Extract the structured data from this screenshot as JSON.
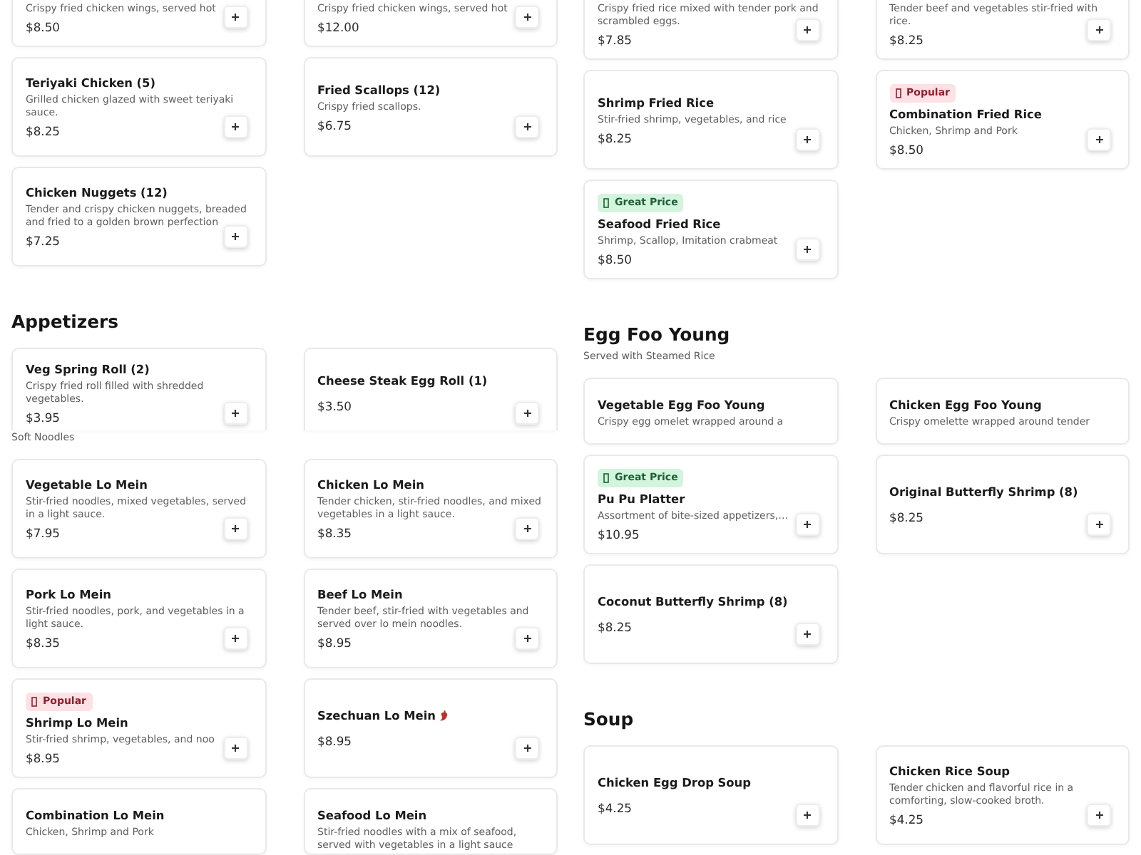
{
  "columns": [
    {
      "sections": [
        {
          "cards": [
            {
              "kind": "top_cut",
              "description": "Crispy fried chicken wings, served hot",
              "price": "$8.50",
              "spicy": false
            },
            {
              "kind": "whole",
              "name": "Teriyaki Chicken (5)",
              "description": "Grilled chicken glazed with sweet teriyaki sauce.",
              "price": "$8.25",
              "spicy": false
            },
            {
              "kind": "whole",
              "name": "Chicken Nuggets (12)",
              "description": "Tender and crispy chicken nuggets, breaded and fried to a golden brown perfection",
              "price": "$7.25",
              "spicy": false
            },
            {
              "kind": "top_cut",
              "description": "Crispy fried chicken wings, served hot",
              "price": "$12.00",
              "spicy": false
            },
            {
              "kind": "whole",
              "name": "Fried Scallops (12)",
              "description": "Crispy fried scallops.",
              "price": "$6.75",
              "spicy": false
            }
          ]
        },
        {
          "title": "Appetizers",
          "cards": [
            {
              "kind": "bottom_cut",
              "name": "Veg Spring Roll (2)",
              "description": "Crispy fried roll filled with shredded vegetables.",
              "price": "$3.95",
              "spicy": false
            },
            {
              "kind": "bottom_cut",
              "name": "Cheese Steak Egg Roll (1)",
              "price": "$3.50",
              "spicy": false
            }
          ]
        },
        {
          "subtitle": "Soft Noodles",
          "cards": [
            {
              "kind": "whole",
              "name": "Vegetable Lo Mein",
              "description": "Stir-fried noodles, mixed vegetables, served in a light sauce.",
              "price": "$7.95",
              "spicy": false
            },
            {
              "kind": "whole",
              "name": "Pork Lo Mein",
              "description": "Stir-fried noodles, pork, and vegetables in a light sauce.",
              "price": "$8.35",
              "spicy": false
            },
            {
              "kind": "whole",
              "badge": {
                "kind": "popular",
                "label": "Popular"
              },
              "name": "Shrimp Lo Mein",
              "description": "Stir-fried shrimp, vegetables, and noo",
              "price": "$8.95",
              "spicy": false
            },
            {
              "kind": "head_only",
              "name": "Combination Lo Mein",
              "description": "Chicken, Shrimp and Pork",
              "spicy": false
            },
            {
              "kind": "whole",
              "name": "Chicken Lo Mein",
              "description": "Tender chicken, stir-fried noodles, and mixed vegetables in a light sauce.",
              "price": "$8.35",
              "spicy": false
            },
            {
              "kind": "whole",
              "name": "Beef Lo Mein",
              "description": "Tender beef, stir-fried with vegetables and served over lo mein noodles.",
              "price": "$8.95",
              "spicy": false
            },
            {
              "kind": "whole",
              "name": "Szechuan Lo Mein",
              "price": "$8.95",
              "spicy": true
            },
            {
              "kind": "head_only",
              "name": "Seafood Lo Mein",
              "description": "Stir-fried noodles with a mix of seafood, served with vegetables in a light sauce",
              "spicy": false
            }
          ]
        }
      ]
    },
    {
      "sections": [
        {
          "cards": [
            {
              "kind": "top_cut",
              "description": "Crispy fried rice mixed with tender pork and scrambled eggs.",
              "price": "$7.85",
              "spicy": false
            },
            {
              "kind": "whole",
              "name": "Shrimp Fried Rice",
              "description": "Stir-fried shrimp, vegetables, and rice",
              "price": "$8.25",
              "spicy": false
            },
            {
              "kind": "whole",
              "badge": {
                "kind": "great_price",
                "label": "Great Price"
              },
              "name": "Seafood Fried Rice",
              "description": "Shrimp, Scallop, Imitation crabmeat",
              "price": "$8.50",
              "spicy": false
            },
            {
              "kind": "top_cut",
              "description": "Tender beef and vegetables stir-fried with rice.",
              "price": "$8.25",
              "spicy": false
            },
            {
              "kind": "whole",
              "badge": {
                "kind": "popular",
                "label": "Popular"
              },
              "name": "Combination Fried Rice",
              "description": "Chicken, Shrimp and Pork",
              "price": "$8.50",
              "spicy": false
            }
          ]
        },
        {
          "title": "Egg Foo Young",
          "subtitle": "Served with Steamed Rice",
          "cards": [
            {
              "kind": "head_only",
              "name": "Vegetable Egg Foo Young",
              "description": "Crispy egg omelet wrapped around a",
              "spicy": false
            },
            {
              "kind": "whole",
              "badge": {
                "kind": "great_price",
                "label": "Great Price"
              },
              "name": "Pu Pu Platter",
              "description": "Assortment of bite-sized appetizers,…",
              "price": "$10.95",
              "spicy": false
            },
            {
              "kind": "whole",
              "name": "Coconut Butterfly Shrimp (8)",
              "price": "$8.25",
              "spicy": false
            },
            {
              "kind": "head_only",
              "name": "Chicken Egg Foo Young",
              "description": "Crispy omelette wrapped around tender",
              "spicy": false
            },
            {
              "kind": "whole",
              "name": "Original Butterfly Shrimp (8)",
              "price": "$8.25",
              "spicy": false
            }
          ]
        },
        {
          "title": "Soup",
          "cards": [
            {
              "kind": "whole",
              "name": "Chicken Egg Drop Soup",
              "price": "$4.25",
              "spicy": false
            },
            {
              "kind": "whole",
              "name": "Chicken Rice Soup",
              "description": "Tender chicken and flavorful rice in a comforting, slow-cooked broth.",
              "price": "$4.25",
              "spicy": false
            }
          ]
        }
      ]
    }
  ]
}
